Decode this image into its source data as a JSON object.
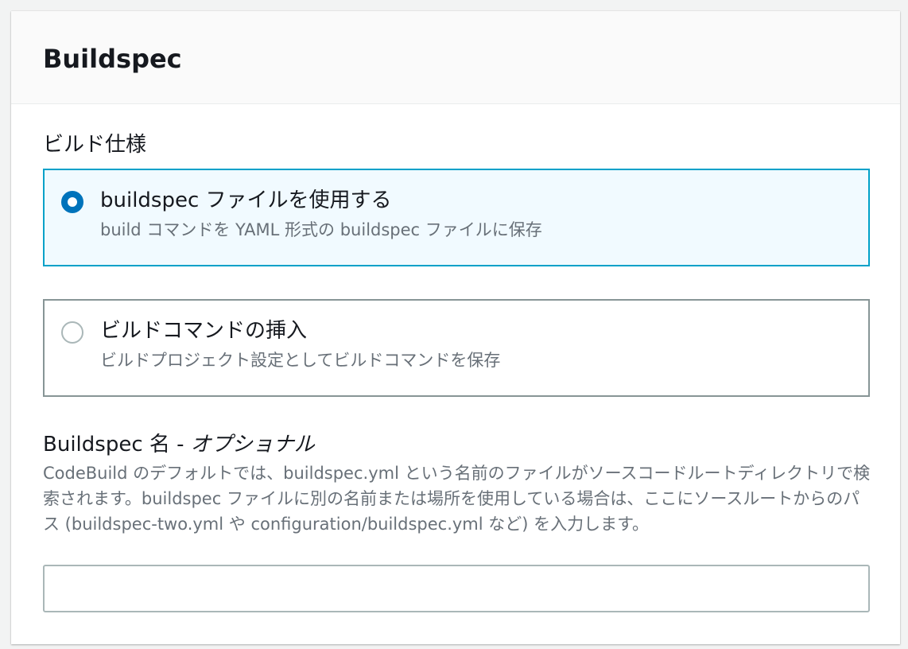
{
  "panel": {
    "title": "Buildspec"
  },
  "build_spec": {
    "label": "ビルド仕様",
    "options": [
      {
        "title": "buildspec ファイルを使用する",
        "description": "build コマンドを YAML 形式の buildspec ファイルに保存",
        "selected": true
      },
      {
        "title": "ビルドコマンドの挿入",
        "description": "ビルドプロジェクト設定としてビルドコマンドを保存",
        "selected": false
      }
    ]
  },
  "buildspec_name": {
    "label": "Buildspec 名",
    "separator": " - ",
    "optional": "オプショナル",
    "description": "CodeBuild のデフォルトでは、buildspec.yml という名前のファイルがソースコードルートディレクトリで検索されます。buildspec ファイルに別の名前または場所を使用している場合は、ここにソースルートからのパス (buildspec-two.yml や configuration/buildspec.yml など) を入力します。",
    "value": "",
    "placeholder": ""
  },
  "colors": {
    "selected_border": "#00a1c9",
    "selected_background": "#f1faff",
    "radio_checked": "#0073bb",
    "secondary_text": "#687078"
  }
}
